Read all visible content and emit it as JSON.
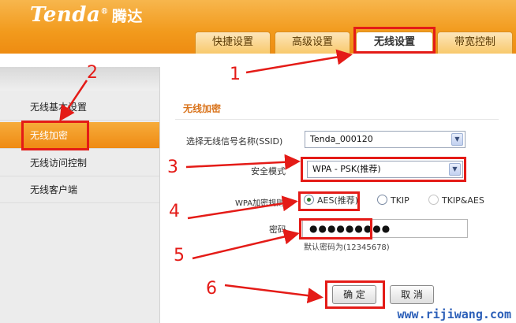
{
  "header": {
    "logo": "Tenda",
    "logo_cn": "腾达",
    "tabs": [
      "快捷设置",
      "高级设置",
      "无线设置",
      "带宽控制"
    ]
  },
  "sidebar": {
    "items": [
      "无线基本设置",
      "无线加密",
      "无线访问控制",
      "无线客户端"
    ]
  },
  "main": {
    "section_title": "无线加密",
    "ssid_label": "选择无线信号名称(SSID)",
    "ssid_value": "Tenda_000120",
    "mode_label": "安全模式",
    "mode_value": "WPA - PSK(推荐)",
    "rule_label": "WPA加密规则",
    "rule_options": [
      "AES(推荐)",
      "TKIP",
      "TKIP&AES"
    ],
    "rule_selected": "AES(推荐)",
    "pwd_label": "密码",
    "pwd_value": "●●●●●●●●●",
    "pwd_hint": "默认密码为(12345678)",
    "ok_label": "确 定",
    "cancel_label": "取 消"
  },
  "annotations": [
    "1",
    "2",
    "3",
    "4",
    "5",
    "6"
  ],
  "watermark": "www.rijiwang.com",
  "colors": {
    "accent": "#f29a1c",
    "highlight": "#e41b17",
    "section_title": "#d9731b"
  }
}
